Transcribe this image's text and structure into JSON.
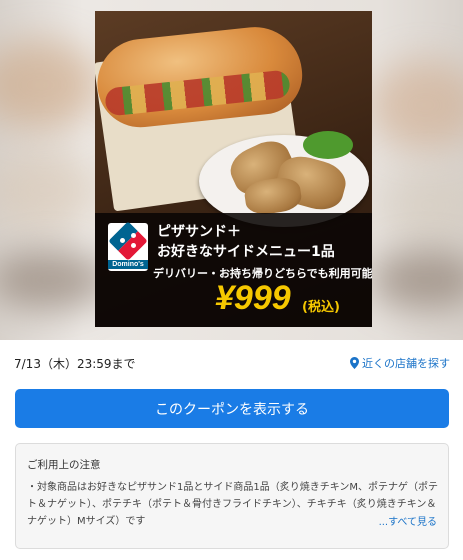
{
  "coupon": {
    "brand": "Domino's",
    "headline_line1": "ピザサンド＋",
    "headline_line2": "お好きなサイドメニュー1品",
    "subline": "デリバリー・お持ち帰りどちらでも利用可能",
    "price": "¥999",
    "tax_note": "(税込)"
  },
  "meta": {
    "expiry": "7/13（木）23:59まで",
    "store_link": "近くの店舗を探す",
    "pin_icon": "location-pin-icon"
  },
  "actions": {
    "show_coupon": "このクーポンを表示する"
  },
  "notes": {
    "title": "ご利用上の注意",
    "body": "・対象商品はお好きなピザサンド1品とサイド商品1品（炙り焼きチキンM、ポテナゲ（ポテト＆ナゲット）、ポテチキ（ポテト＆骨付きフライドチキン）、チキチキ（炙り焼きチキン＆ナゲット）Mサイズ）です",
    "more": "...すべて見る"
  },
  "colors": {
    "accent": "#1a7ce6",
    "link": "#1a73c8",
    "price": "#f6c800",
    "brand_blue": "#006491",
    "brand_red": "#e31837"
  }
}
